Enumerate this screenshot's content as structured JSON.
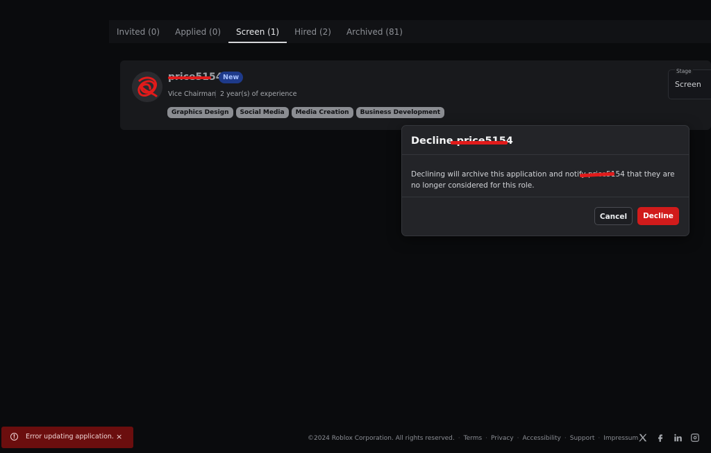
{
  "tabs": [
    {
      "label": "Invited (0)"
    },
    {
      "label": "Applied (0)"
    },
    {
      "label": "Screen (1)",
      "active": true
    },
    {
      "label": "Hired (2)"
    },
    {
      "label": "Archived (81)"
    }
  ],
  "candidate": {
    "name": "price5154",
    "badge": "New",
    "role": "Vice Chairman",
    "experience": "2 year(s) of experience",
    "skills": [
      "Graphics Design",
      "Social Media",
      "Media Creation",
      "Business Development"
    ]
  },
  "stage": {
    "label": "Stage",
    "value": "Screen"
  },
  "modal": {
    "title": "Decline price5154",
    "body": "Declining will archive this application and notify price5154 that they are no longer considered for this role.",
    "cancel_label": "Cancel",
    "decline_label": "Decline"
  },
  "toast": {
    "message": "Error updating application.",
    "close": "×"
  },
  "footer": {
    "copyright": "©2024 Roblox Corporation. All rights reserved.",
    "links": [
      "Terms",
      "Privacy",
      "Accessibility",
      "Support",
      "Impressum"
    ]
  },
  "social_icons": [
    "x-icon",
    "facebook-icon",
    "linkedin-icon",
    "instagram-icon"
  ],
  "colors": {
    "accent": "#d11b1b",
    "toast_bg": "#6b0e0e",
    "badge_bg": "#1e3a8a"
  }
}
